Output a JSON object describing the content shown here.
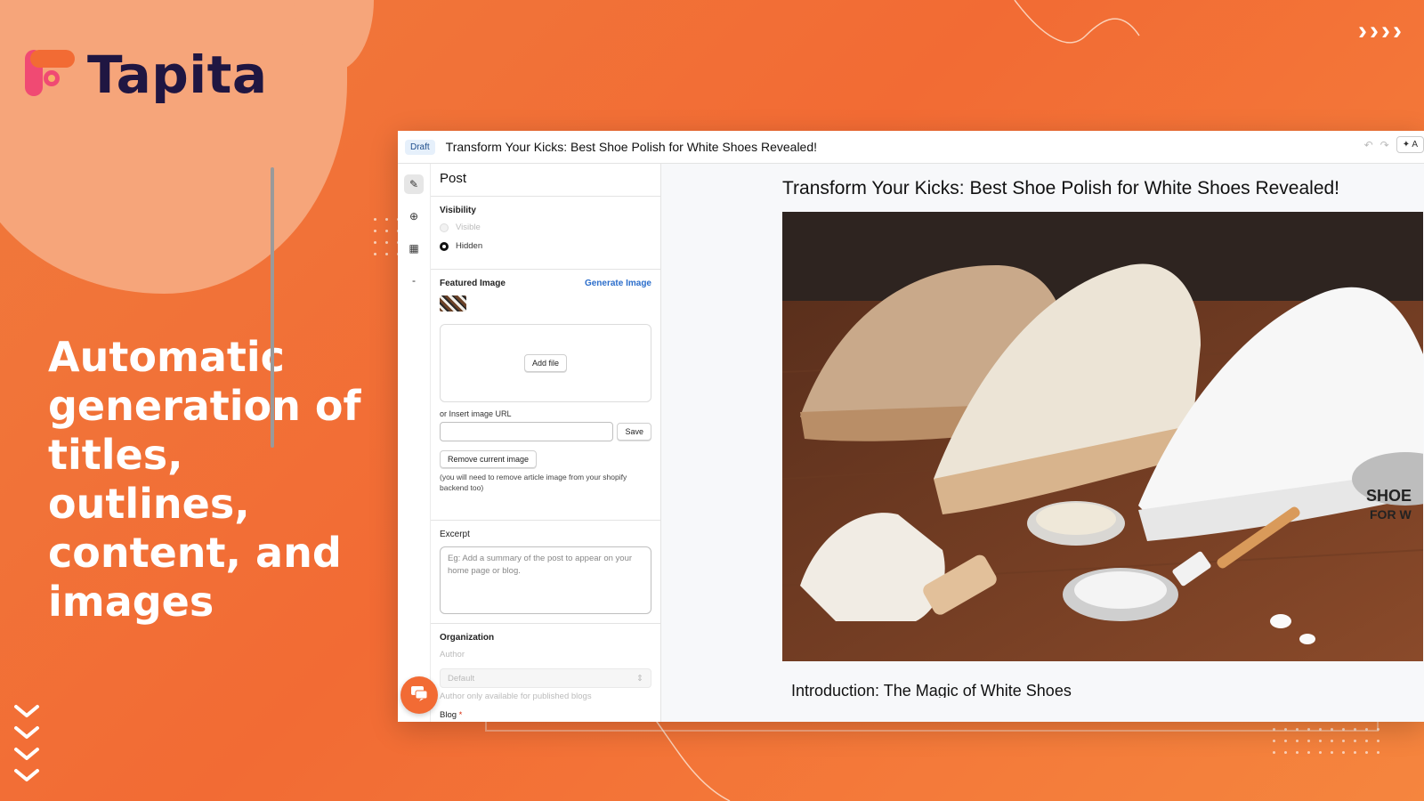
{
  "brand": {
    "name": "Tapita"
  },
  "headline": "Automatic generation of titles, outlines, content, and images",
  "editor": {
    "status_badge": "Draft",
    "document_title": "Transform Your Kicks: Best Shoe Polish for White Shoes Revealed!",
    "ai_button": "A",
    "panel_title": "Post",
    "visibility": {
      "label": "Visibility",
      "options": [
        "Visible",
        "Hidden"
      ],
      "selected": "Hidden"
    },
    "featured_image": {
      "label": "Featured Image",
      "generate_link": "Generate Image",
      "add_file": "Add file",
      "url_label": "or Insert image URL",
      "save": "Save",
      "remove": "Remove current image",
      "note": "(you will need to remove article image from your shopify backend too)"
    },
    "excerpt": {
      "label": "Excerpt",
      "placeholder": "Eg: Add a summary of the post to appear on your home page or blog."
    },
    "organization": {
      "label": "Organization",
      "author_label": "Author",
      "author_value": "Default",
      "author_note": "Author only available for published blogs",
      "blog_label": "Blog",
      "required_mark": "*"
    },
    "article": {
      "title": "Transform Your Kicks: Best Shoe Polish for White Shoes Revealed!",
      "image_label_shoe": "SHOE",
      "image_label_for": "FOR W",
      "intro_heading": "Introduction: The Magic of White Shoes"
    }
  },
  "icons": {
    "edit": "edit-icon",
    "add": "plus-circle-icon",
    "table": "table-icon",
    "more": "dash-icon",
    "undo": "undo-icon",
    "redo": "redo-icon",
    "ai": "sparkle-icon",
    "chat": "chat-icon"
  },
  "colors": {
    "accent": "#f26b34",
    "brand_dark": "#1f1642",
    "link": "#2c6ecb",
    "badge": "#e6f0fb"
  }
}
